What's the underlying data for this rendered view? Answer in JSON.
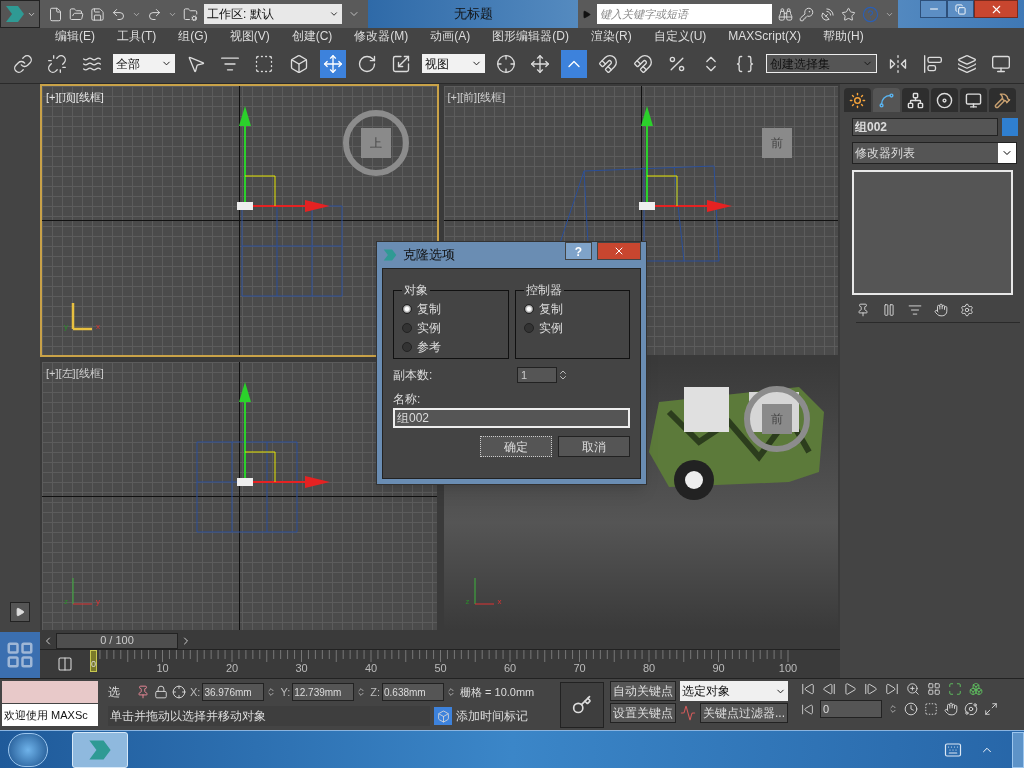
{
  "title_bar": {
    "workspace": "工作区: 默认",
    "title": "无标题",
    "search_placeholder": "键入关键字或短语"
  },
  "menu": [
    "编辑(E)",
    "工具(T)",
    "组(G)",
    "视图(V)",
    "创建(C)",
    "修改器(M)",
    "动画(A)",
    "图形编辑器(D)",
    "渲染(R)",
    "自定义(U)",
    "MAXScript(X)",
    "帮助(H)"
  ],
  "toolbar": [
    {
      "kind": "link",
      "selected": false
    },
    {
      "kind": "unlink",
      "selected": false
    },
    {
      "kind": "bind",
      "selected": false
    },
    {
      "kind": "dropdown",
      "value": "全部",
      "selected": false
    },
    {
      "kind": "select",
      "selected": false
    },
    {
      "kind": "select-by-name",
      "selected": false
    },
    {
      "kind": "region",
      "selected": false
    },
    {
      "kind": "crossing",
      "selected": false
    },
    {
      "kind": "move",
      "selected": true
    },
    {
      "kind": "rotate",
      "selected": false
    },
    {
      "kind": "scale",
      "selected": false
    },
    {
      "kind": "dropdown",
      "value": "视图",
      "selected": false
    },
    {
      "kind": "pivot",
      "selected": false
    },
    {
      "kind": "manipulate",
      "selected": false
    },
    {
      "kind": "keyboard",
      "selected": true
    },
    {
      "kind": "snap",
      "selected": false
    },
    {
      "kind": "angle-snap",
      "selected": false
    },
    {
      "kind": "percent-snap",
      "selected": false
    },
    {
      "kind": "spinner-snap",
      "selected": false
    },
    {
      "kind": "named-sets",
      "selected": false
    },
    {
      "kind": "dropdown",
      "value": "创建选择集",
      "selected": false
    },
    {
      "kind": "mirror",
      "selected": false
    },
    {
      "kind": "align",
      "selected": false
    },
    {
      "kind": "layers",
      "selected": false
    },
    {
      "kind": "render",
      "selected": false
    }
  ],
  "viewports": [
    {
      "kind": "top",
      "label": "[+][顶][线框]",
      "cube": "上",
      "active": true,
      "tripod": [
        "y",
        "x"
      ]
    },
    {
      "kind": "front",
      "label": "[+][前][线框]",
      "cube": "前",
      "active": false
    },
    {
      "kind": "left",
      "label": "[+][左][线框]",
      "active": false,
      "tripod": [
        "z",
        "y"
      ]
    },
    {
      "kind": "perspective",
      "cube": "前",
      "active": false,
      "tripod": [
        "z",
        "x"
      ]
    }
  ],
  "dialog": {
    "title": "克隆选项",
    "help": "?",
    "groups": [
      {
        "title": "对象",
        "options": [
          {
            "label": "复制",
            "selected": true
          },
          {
            "label": "实例",
            "selected": false
          },
          {
            "label": "参考",
            "selected": false
          }
        ]
      },
      {
        "title": "控制器",
        "options": [
          {
            "label": "复制",
            "selected": true
          },
          {
            "label": "实例",
            "selected": false
          }
        ]
      }
    ],
    "copies_label": "副本数:",
    "copies": "1",
    "name_label": "名称:",
    "name": "组002",
    "ok": "确定",
    "cancel": "取消"
  },
  "command_panel": {
    "tabs": [
      {
        "kind": "create",
        "selected": false
      },
      {
        "kind": "modify",
        "selected": true
      },
      {
        "kind": "hierarchy",
        "selected": false
      },
      {
        "kind": "motion",
        "selected": false
      },
      {
        "kind": "display",
        "selected": false
      },
      {
        "kind": "utilities",
        "selected": false
      }
    ],
    "object_name": "组002",
    "color": "#2f7fd0",
    "modifier_list": "修改器列表"
  },
  "time_slider": "0 / 100",
  "ruler": [
    "0",
    "10",
    "20",
    "30",
    "40",
    "50",
    "60",
    "70",
    "80",
    "90",
    "100"
  ],
  "status": {
    "listener_output": "欢迎使用 MAXSc",
    "selection": "选",
    "x_label": "X:",
    "x": "36.976mm",
    "y_label": "Y:",
    "y": "12.739mm",
    "z_label": "Z:",
    "z": "0.638mm",
    "grid": "栅格 = 10.0mm",
    "prompt": "单击并拖动以选择并移动对象",
    "add_tag": "添加时间标记",
    "auto_key": "自动关键点",
    "key_set": "选定对象",
    "set_key": "设置关键点",
    "key_filters": "关键点过滤器...",
    "frame": "0"
  }
}
